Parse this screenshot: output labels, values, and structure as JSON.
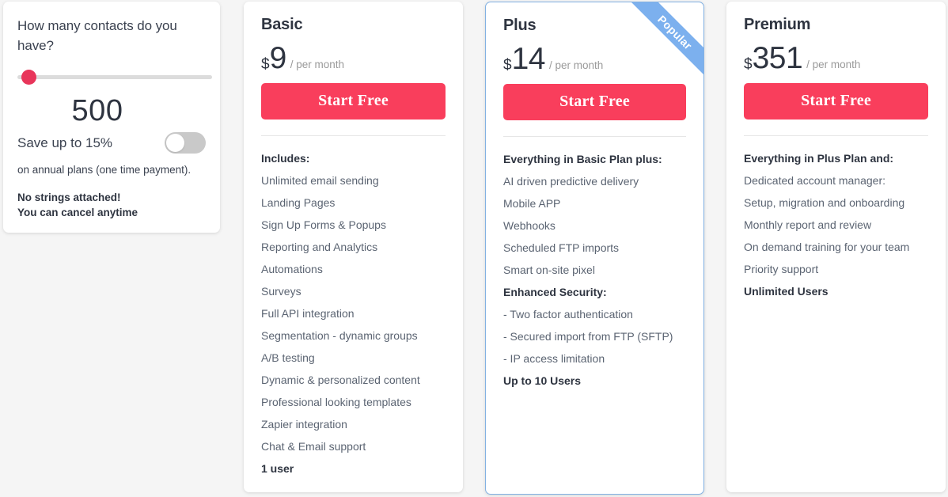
{
  "calculator": {
    "question": "How many contacts do you have?",
    "contacts_value": "500",
    "slider": {
      "min": 0,
      "max": 100,
      "value": 0,
      "handle_color": "#e8355a",
      "track_color": "#dcdcdc"
    },
    "annual_toggle": {
      "label": "Save up to 15%",
      "state": "off",
      "track_color": "#c9c9c9"
    },
    "annual_note": "on annual plans (one time payment).",
    "no_strings_line1": "No strings attached!",
    "no_strings_line2": "You can cancel anytime"
  },
  "accent_colors": {
    "cta_red": "#f93e5c",
    "ribbon_blue": "#7cb0ee",
    "highlight_border": "#82b1e3",
    "page_background": "#f5f5f5"
  },
  "plans": [
    {
      "name": "Basic",
      "currency": "$",
      "amount": "9",
      "period": "/ per month",
      "cta_label": "Start Free",
      "highlighted": false,
      "ribbon": null,
      "features": [
        {
          "text": "Includes:",
          "bold": true
        },
        {
          "text": "Unlimited email sending",
          "bold": false
        },
        {
          "text": "Landing Pages",
          "bold": false
        },
        {
          "text": "Sign Up Forms & Popups",
          "bold": false
        },
        {
          "text": "Reporting and Analytics",
          "bold": false
        },
        {
          "text": "Automations",
          "bold": false
        },
        {
          "text": "Surveys",
          "bold": false
        },
        {
          "text": "Full API integration",
          "bold": false
        },
        {
          "text": "Segmentation - dynamic groups",
          "bold": false
        },
        {
          "text": "A/B testing",
          "bold": false
        },
        {
          "text": "Dynamic & personalized content",
          "bold": false
        },
        {
          "text": "Professional looking templates",
          "bold": false
        },
        {
          "text": "Zapier integration",
          "bold": false
        },
        {
          "text": "Chat & Email support",
          "bold": false
        },
        {
          "text": "1 user",
          "bold": true
        }
      ]
    },
    {
      "name": "Plus",
      "currency": "$",
      "amount": "14",
      "period": "/ per month",
      "cta_label": "Start Free",
      "highlighted": true,
      "ribbon": "Popular",
      "features": [
        {
          "text": "Everything in Basic Plan plus:",
          "bold": true
        },
        {
          "text": "AI driven predictive delivery",
          "bold": false
        },
        {
          "text": "Mobile APP",
          "bold": false
        },
        {
          "text": "Webhooks",
          "bold": false
        },
        {
          "text": "Scheduled FTP imports",
          "bold": false
        },
        {
          "text": "Smart on-site pixel",
          "bold": false
        },
        {
          "text": "Enhanced Security:",
          "bold": true
        },
        {
          "text": "- Two factor authentication",
          "bold": false
        },
        {
          "text": "- Secured import from FTP (SFTP)",
          "bold": false
        },
        {
          "text": "- IP access limitation",
          "bold": false
        },
        {
          "text": "Up to 10 Users",
          "bold": true
        }
      ]
    },
    {
      "name": "Premium",
      "currency": "$",
      "amount": "351",
      "period": "/ per month",
      "cta_label": "Start Free",
      "highlighted": false,
      "ribbon": null,
      "features": [
        {
          "text": "Everything in Plus Plan and:",
          "bold": true
        },
        {
          "text": "Dedicated account manager:",
          "bold": false
        },
        {
          "text": "Setup, migration and onboarding",
          "bold": false
        },
        {
          "text": "Monthly report and review",
          "bold": false
        },
        {
          "text": "On demand training for your team",
          "bold": false
        },
        {
          "text": "Priority support",
          "bold": false
        },
        {
          "text": "Unlimited Users",
          "bold": true
        }
      ]
    }
  ]
}
